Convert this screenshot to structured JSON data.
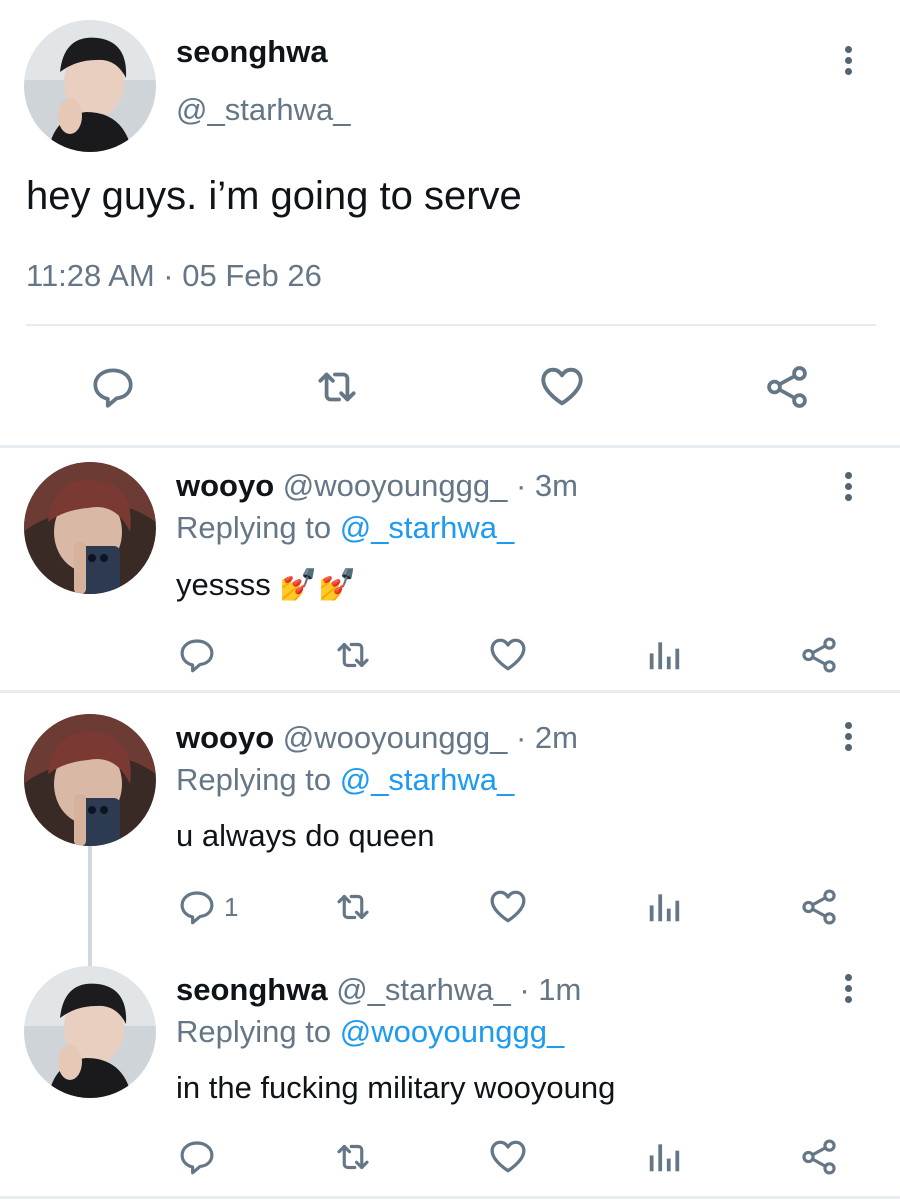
{
  "colors": {
    "accent": "#1d9bf0",
    "text": "#0f1419",
    "muted": "#657786",
    "divider": "#e6ecf0"
  },
  "main_tweet": {
    "display_name": "seonghwa",
    "handle": "@_starhwa_",
    "text": "hey guys. i’m going to serve",
    "timestamp": "11:28 AM · 05 Feb 26",
    "actions": [
      "reply-icon",
      "retweet-icon",
      "like-icon",
      "share-icon"
    ]
  },
  "replies": [
    {
      "display_name": "wooyo",
      "handle": "@wooyounggg_",
      "sep_time": " · 3m",
      "replying_prefix": "Replying to ",
      "replying_to": "@_starhwa_",
      "text": "yessss 💅💅",
      "reply_count": ""
    },
    {
      "display_name": "wooyo",
      "handle": "@wooyounggg_",
      "sep_time": " · 2m",
      "replying_prefix": "Replying to ",
      "replying_to": "@_starhwa_",
      "text": "u always do queen",
      "reply_count": "1"
    },
    {
      "display_name": "seonghwa",
      "handle": "@_starhwa_",
      "sep_time": " · 1m",
      "replying_prefix": "Replying to ",
      "replying_to": "@wooyounggg_",
      "text": "in the fucking military wooyoung",
      "reply_count": ""
    }
  ]
}
